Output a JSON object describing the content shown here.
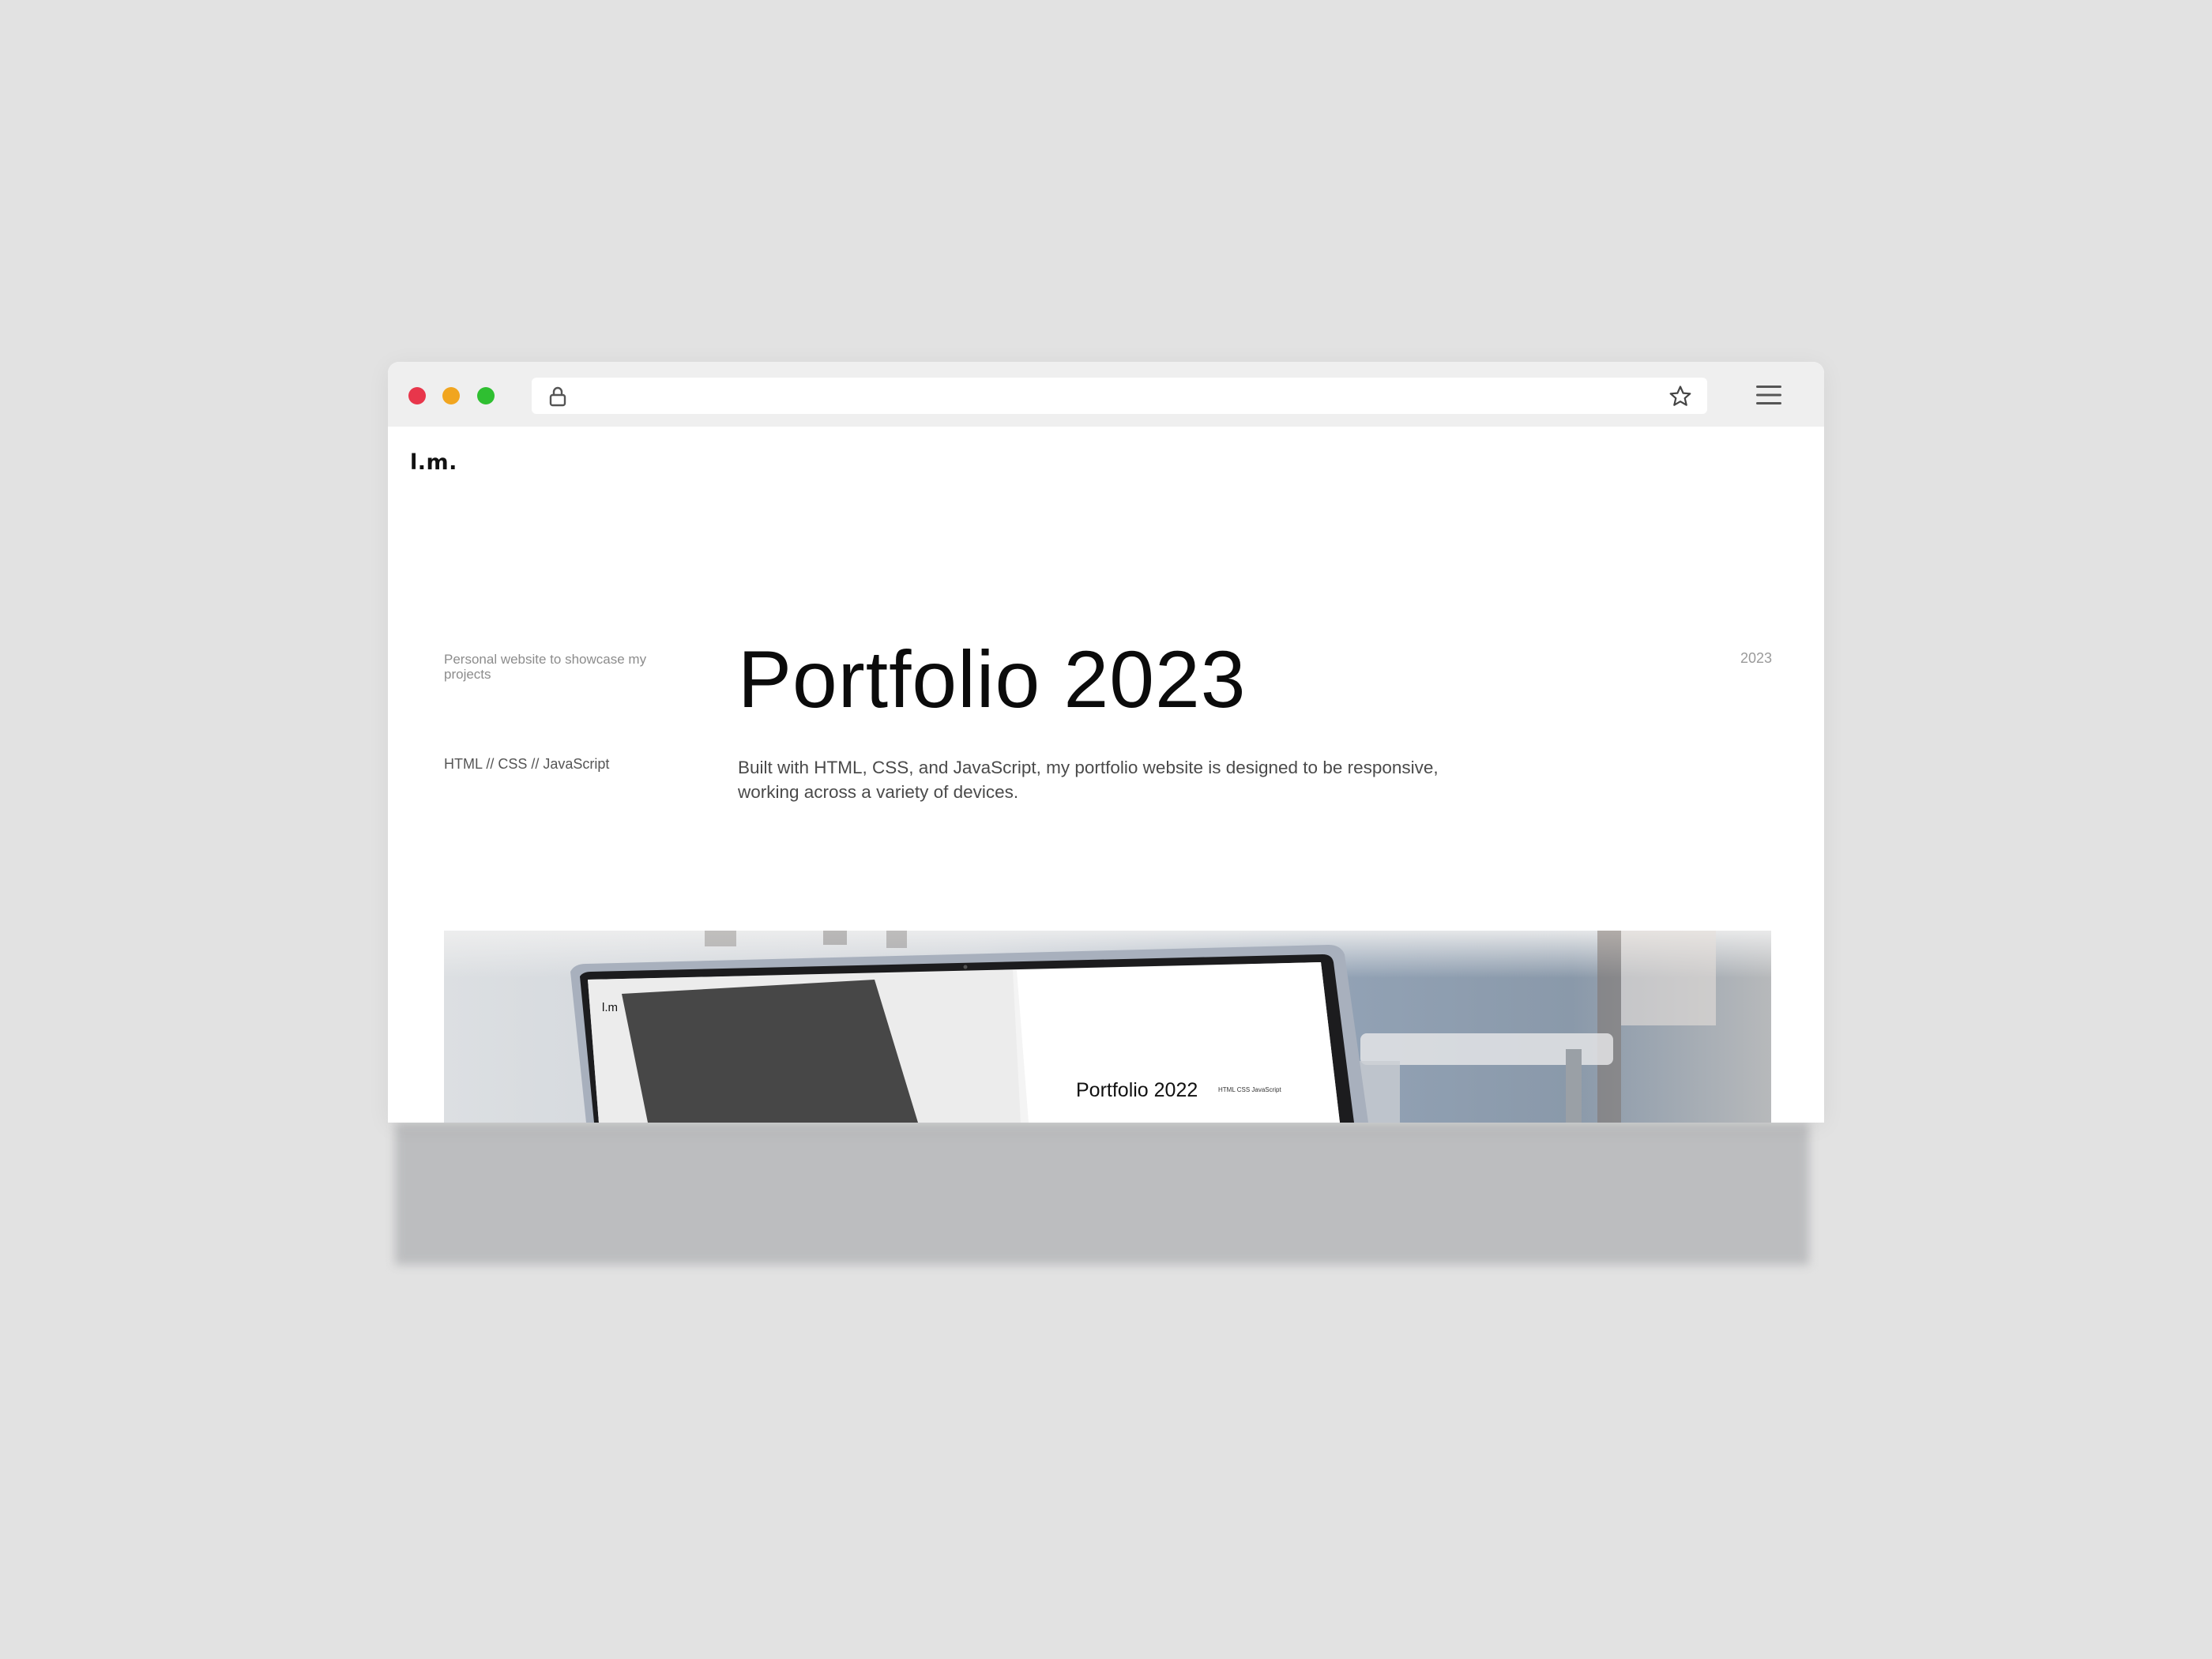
{
  "browser": {
    "controls": [
      "close",
      "minimize",
      "maximize"
    ],
    "url": "",
    "icons": [
      "lock-icon",
      "star-icon",
      "hamburger-menu-icon"
    ]
  },
  "site": {
    "logo": "l.m."
  },
  "project": {
    "summary": "Personal website to showcase my projects",
    "tech": "HTML // CSS // JavaScript",
    "title": "Portfolio 2023",
    "description": "Built with HTML, CSS, and JavaScript, my portfolio website is designed to be responsive, working across a variety of devices.",
    "year": "2023"
  },
  "hero_image": {
    "screen_logo": "l.m",
    "screen_title": "Portfolio 2022",
    "screen_tech": "HTML CSS JavaScript"
  },
  "colors": {
    "close": "#e8364b",
    "minimize": "#f1a51f",
    "maximize": "#2fbf31",
    "background": "#e2e2e2"
  }
}
